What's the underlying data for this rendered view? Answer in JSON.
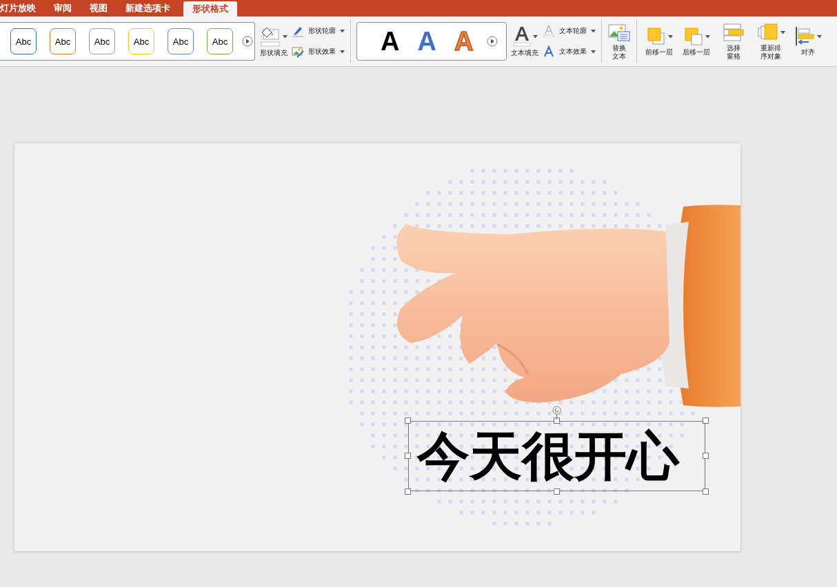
{
  "tabs": [
    {
      "label": "灯片放映",
      "selected": false
    },
    {
      "label": "审阅",
      "selected": false
    },
    {
      "label": "视图",
      "selected": false
    },
    {
      "label": "新建选项卡",
      "selected": false
    },
    {
      "label": "形状格式",
      "selected": true
    }
  ],
  "shape_styles": [
    {
      "label": "Abc",
      "color": "#3a6fc4"
    },
    {
      "label": "Abc",
      "color": "#e0782e"
    },
    {
      "label": "Abc",
      "color": "#9a9a9a"
    },
    {
      "label": "Abc",
      "color": "#f2c21a"
    },
    {
      "label": "Abc",
      "color": "#5b8fd0"
    },
    {
      "label": "Abc",
      "color": "#6cb34a"
    }
  ],
  "shape_fill": {
    "label": "形状填充"
  },
  "shape_commands": [
    {
      "kind": "outline",
      "label": "形状轮廓"
    },
    {
      "kind": "effects",
      "label": "形状效果"
    }
  ],
  "wordart_styles": [
    {
      "kind": "filled",
      "label": "A",
      "color": "#000000"
    },
    {
      "kind": "filled",
      "label": "A",
      "color": "#3f72c4"
    },
    {
      "kind": "outline",
      "label": "A",
      "color": "#e8844a"
    }
  ],
  "text_fill": {
    "label": "文本填充"
  },
  "text_commands": [
    {
      "kind": "outline",
      "label": "文本轮廓"
    },
    {
      "kind": "effects",
      "label": "文本效果"
    }
  ],
  "alt_text": {
    "label": "替换文本"
  },
  "arrange_commands": [
    {
      "kind": "forward",
      "label": "前移一层",
      "dropdown": true
    },
    {
      "kind": "backward",
      "label": "后移一层",
      "dropdown": true
    },
    {
      "kind": "pane",
      "label": "选择窗格",
      "dropdown": false
    },
    {
      "kind": "reorder",
      "label": "重新排序对象",
      "dropdown": true
    },
    {
      "kind": "align",
      "label": "对齐",
      "dropdown": true
    }
  ],
  "slide": {
    "title": "今天很开心"
  }
}
